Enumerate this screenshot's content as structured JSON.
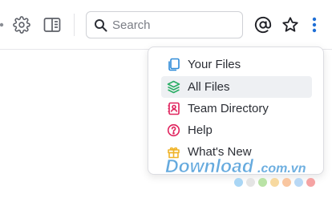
{
  "search": {
    "placeholder": "Search"
  },
  "toolbar": {
    "icons": [
      "settings-icon",
      "panel-toggle-icon",
      "mention-icon",
      "star-icon",
      "more-options-icon"
    ],
    "accent": "#1f6fd6"
  },
  "menu": {
    "items": [
      {
        "label": "Your Files",
        "icon": "files-icon",
        "color": "#2f8bd8"
      },
      {
        "label": "All Files",
        "icon": "layers-icon",
        "color": "#2bae66"
      },
      {
        "label": "Team Directory",
        "icon": "directory-icon",
        "color": "#e0245e"
      },
      {
        "label": "Help",
        "icon": "help-icon",
        "color": "#e0245e"
      },
      {
        "label": "What's New",
        "icon": "gift-icon",
        "color": "#f0b429"
      }
    ],
    "hover_color": "#eef0f3"
  },
  "watermark": {
    "text": "Download.com.vn",
    "dot_colors": [
      "#a9d6f5",
      "#e4e4e4",
      "#b9e3a6",
      "#f7d9a0",
      "#f9c6a0",
      "#b8d8f5",
      "#f5a3a3"
    ]
  }
}
